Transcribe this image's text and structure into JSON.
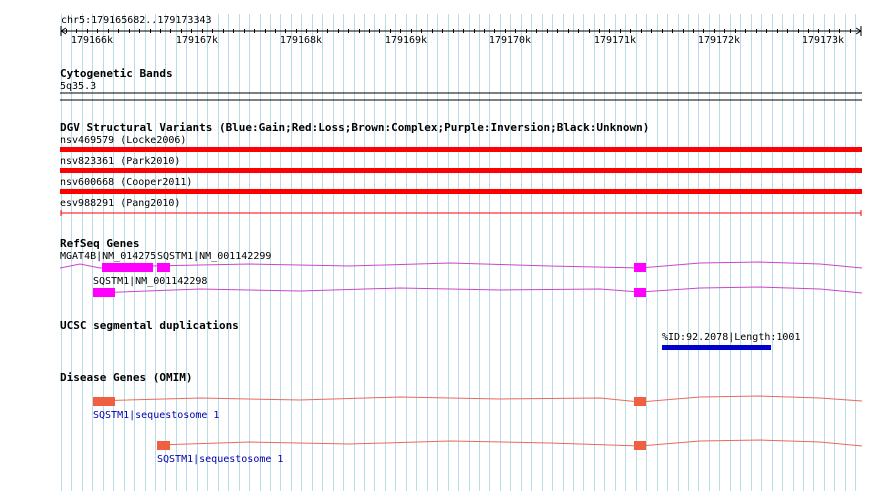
{
  "ruler": {
    "location": "chr5:179165682..179173343",
    "ticks": [
      "179166k",
      "179167k",
      "179168k",
      "179169k",
      "179170k",
      "179171k",
      "179172k",
      "179173k"
    ]
  },
  "cytogenetic": {
    "title": "Cytogenetic Bands",
    "band": "5q35.3"
  },
  "dgv": {
    "title": "DGV Structural Variants (Blue:Gain;Red:Loss;Brown:Complex;Purple:Inversion;Black:Unknown)",
    "variants": [
      {
        "label": "nsv469579 (Locke2006)",
        "type": "loss"
      },
      {
        "label": "nsv823361 (Park2010)",
        "type": "loss"
      },
      {
        "label": "nsv600668 (Cooper2011)",
        "type": "loss"
      },
      {
        "label": "esv988291 (Pang2010)",
        "type": "loss"
      }
    ]
  },
  "refseq": {
    "title": "RefSeq Genes",
    "labels": {
      "mgat4b": "MGAT4B|NM_014275",
      "sqstm1_a": "SQSTM1|NM_001142299",
      "sqstm1_b": "SQSTM1|NM_001142298"
    }
  },
  "segdup": {
    "title": "UCSC segmental duplications",
    "label": "%ID:92.2078|Length:1001"
  },
  "omim": {
    "title": "Disease Genes (OMIM)",
    "genes": [
      {
        "label": "SQSTM1|sequestosome 1"
      },
      {
        "label": "SQSTM1|sequestosome 1"
      }
    ]
  },
  "colors": {
    "grid": "#b8dce8",
    "loss": "#ff0000",
    "refseq": "#ff00ff",
    "intron_refseq": "#cc44cc",
    "segdup": "#0000cc",
    "omim_exon": "#f06040",
    "omim_intron": "#e86a5a"
  }
}
